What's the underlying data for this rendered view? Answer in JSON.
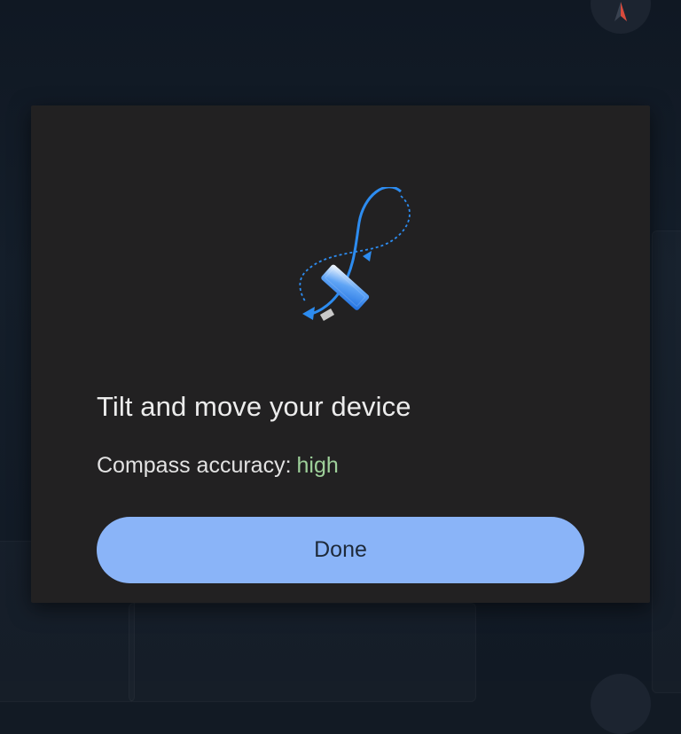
{
  "dialog": {
    "title": "Tilt and move your device",
    "accuracy_label": "Compass accuracy:",
    "accuracy_value": "high",
    "done_label": "Done"
  },
  "colors": {
    "accent": "#8ab4f8",
    "accuracy_high": "#9ed09a",
    "dialog_bg": "#222122",
    "path_blue": "#2d8cf0"
  },
  "icons": {
    "illustration": "figure-eight-phone-icon",
    "fab": "compass-icon"
  }
}
